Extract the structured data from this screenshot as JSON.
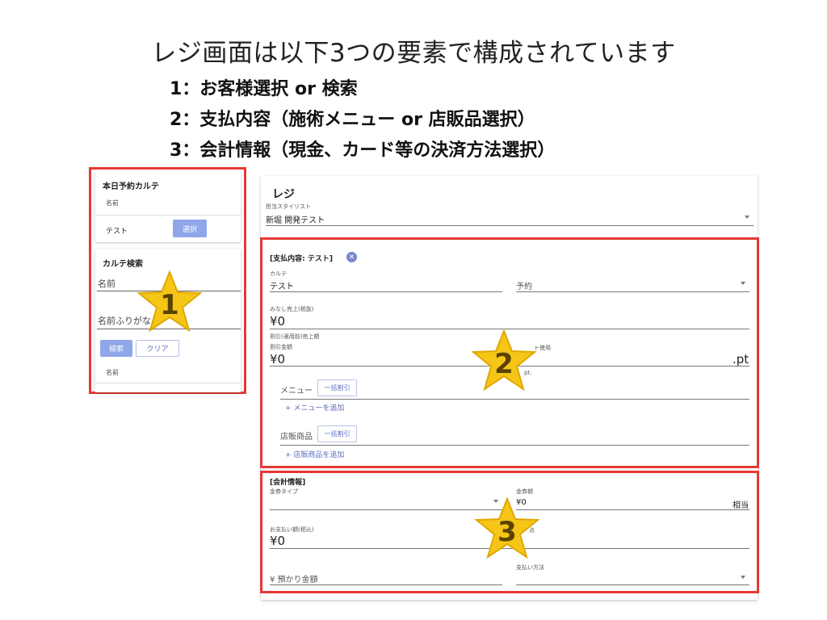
{
  "heading": {
    "title": "レジ画面は以下3つの要素で構成されています",
    "items": [
      "1：お客様選択 or 検索",
      "2：支払内容（施術メニュー or 店販品選択）",
      "3：会計情報（現金、カード等の決済方法選択）"
    ]
  },
  "left_panel": {
    "today_title": "本日予約カルテ",
    "today_name_label": "名前",
    "today_row_name": "テスト",
    "select_button": "選択",
    "search_title": "カルテ検索",
    "name_field_label": "名前",
    "kana_field_label": "名前ふりがな",
    "search_button": "検索",
    "clear_button": "クリア",
    "result_name_label": "名前"
  },
  "main": {
    "title": "レジ",
    "stylist_label": "担当スタイリスト",
    "stylist_value": "新堀 開発テスト",
    "payment_section": {
      "header": "[支払内容: テスト]",
      "karte_label": "カルテ",
      "karte_value": "テスト",
      "reservation_placeholder": "予約",
      "deemed_sales_label": "みなし売上(税抜)",
      "deemed_sales_value": "¥0",
      "discount_applied_label": "割引(適用前)売上額",
      "discount_amount_label": "割引金額",
      "discount_amount_value": "¥0",
      "point_use_label": "ト使用",
      "point_unit": ".pt",
      "point_sub_label": "pt.",
      "menu_label": "メニュー",
      "bulk_discount_label": "一括割引",
      "add_menu_link": "+ メニューを追加",
      "store_product_label": "店販商品",
      "add_product_link": "+ 店販商品を追加"
    },
    "account_section": {
      "header": "[会計情報]",
      "voucher_type_label": "金券タイプ",
      "voucher_amount_label": "金券額",
      "voucher_amount_value": "¥0",
      "equivalent_label": "相当",
      "payment_amount_label": "お支払い額(税込)",
      "payment_amount_value": "¥0",
      "hidden_label": "点",
      "deposit_placeholder": "¥ 預かり金額",
      "payment_method_label": "支払い方法"
    }
  },
  "markers": [
    "1",
    "2",
    "3"
  ],
  "colors": {
    "highlight_border": "#e53935",
    "primary_button": "#8fa7e8",
    "star_fill": "#f5c518"
  }
}
